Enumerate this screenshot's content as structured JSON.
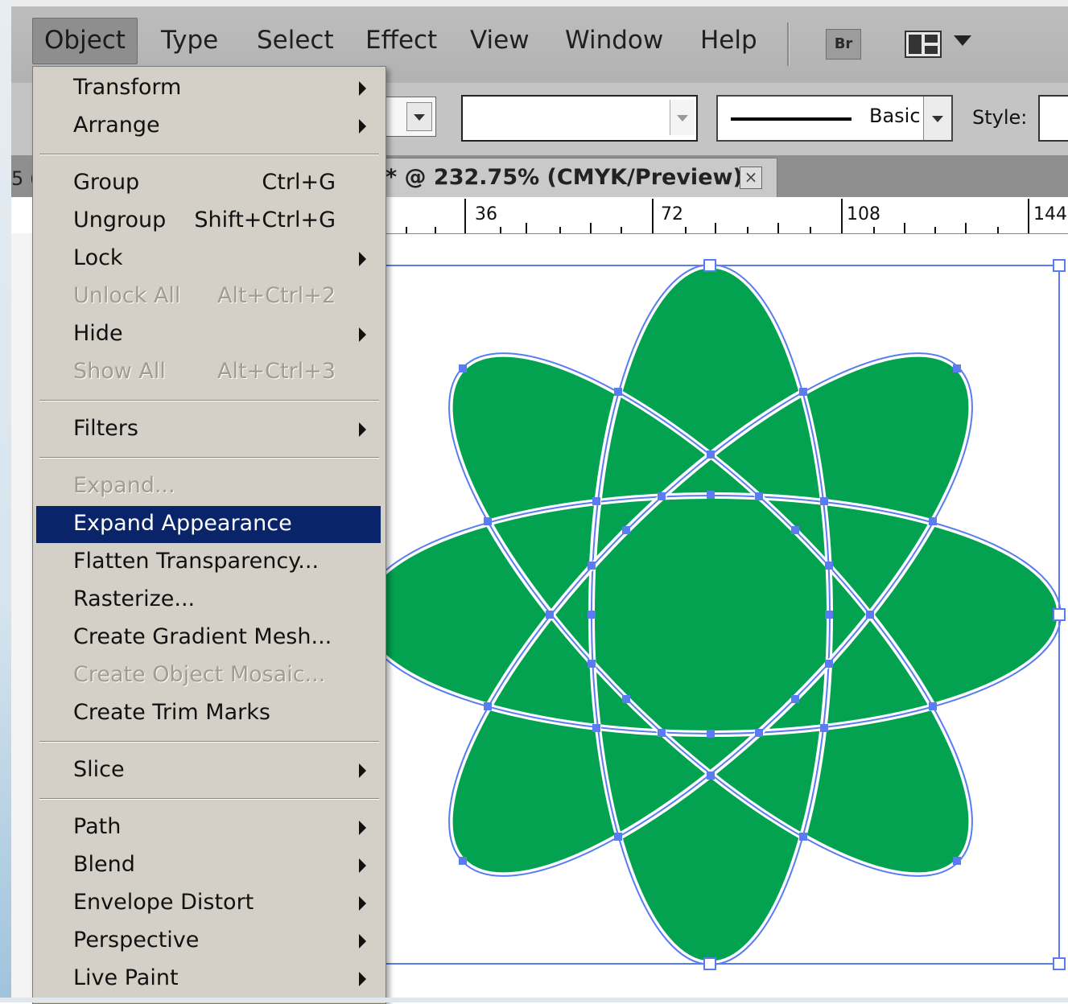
{
  "menubar": {
    "items": [
      {
        "label": "Object",
        "active": true
      },
      {
        "label": "Type"
      },
      {
        "label": "Select"
      },
      {
        "label": "Effect"
      },
      {
        "label": "View"
      },
      {
        "label": "Window"
      },
      {
        "label": "Help"
      }
    ],
    "bridge_label": "Br",
    "workspace_icon": "workspace-switcher-icon"
  },
  "controlbar": {
    "stroke_style": "Basic",
    "style_label": "Style:"
  },
  "document": {
    "tab_title": "* @ 232.75% (CMYK/Preview)",
    "close_glyph": "×",
    "left_partial_tab": "5 ("
  },
  "ruler": {
    "labels": [
      "36",
      "72",
      "108",
      "144"
    ]
  },
  "object_menu": {
    "items": [
      {
        "label": "Transform",
        "shortcut": "",
        "submenu": true
      },
      {
        "label": "Arrange",
        "shortcut": "",
        "submenu": true
      },
      {
        "sep": true
      },
      {
        "label": "Group",
        "shortcut": "Ctrl+G"
      },
      {
        "label": "Ungroup",
        "shortcut": "Shift+Ctrl+G"
      },
      {
        "label": "Lock",
        "shortcut": "",
        "submenu": true
      },
      {
        "label": "Unlock All",
        "shortcut": "Alt+Ctrl+2",
        "disabled": true
      },
      {
        "label": "Hide",
        "shortcut": "",
        "submenu": true
      },
      {
        "label": "Show All",
        "shortcut": "Alt+Ctrl+3",
        "disabled": true
      },
      {
        "sep": true
      },
      {
        "label": "Filters",
        "shortcut": "",
        "submenu": true
      },
      {
        "sep": true
      },
      {
        "label": "Expand...",
        "shortcut": "",
        "disabled": true
      },
      {
        "label": "Expand Appearance",
        "shortcut": "",
        "highlighted": true
      },
      {
        "label": "Flatten Transparency...",
        "shortcut": ""
      },
      {
        "label": "Rasterize...",
        "shortcut": ""
      },
      {
        "label": "Create Gradient Mesh...",
        "shortcut": ""
      },
      {
        "label": "Create Object Mosaic...",
        "shortcut": "",
        "disabled": true
      },
      {
        "label": "Create Trim Marks",
        "shortcut": ""
      },
      {
        "sep": true
      },
      {
        "label": "Slice",
        "shortcut": "",
        "submenu": true
      },
      {
        "sep": true
      },
      {
        "label": "Path",
        "shortcut": "",
        "submenu": true
      },
      {
        "label": "Blend",
        "shortcut": "",
        "submenu": true
      },
      {
        "label": "Envelope Distort",
        "shortcut": "",
        "submenu": true
      },
      {
        "label": "Perspective",
        "shortcut": "",
        "submenu": true
      },
      {
        "label": "Live Paint",
        "shortcut": "",
        "submenu": true
      }
    ]
  },
  "artwork": {
    "fill_color": "#03a251",
    "selection_color": "#5b7cf0",
    "description_icon": "flower-rosette-artwork"
  }
}
